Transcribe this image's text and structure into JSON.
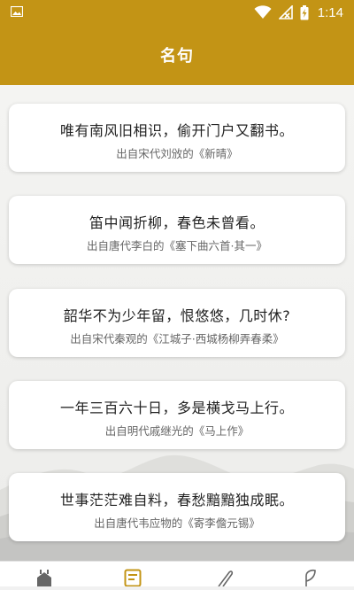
{
  "status_bar": {
    "time": "1:14",
    "icons": [
      "image-icon",
      "wifi-icon",
      "signal-off-icon",
      "battery-charging-icon"
    ]
  },
  "app_bar": {
    "title": "名句"
  },
  "colors": {
    "accent": "#c39415",
    "card_bg": "#ffffff",
    "text_primary": "#222222",
    "text_secondary": "#666666"
  },
  "quotes": [
    {
      "line": "唯有南风旧相识，偷开门户又翻书。",
      "source": "出自宋代刘攽的《新晴》"
    },
    {
      "line": "笛中闻折柳，春色未曾看。",
      "source": "出自唐代李白的《塞下曲六首·其一》"
    },
    {
      "line": "韶华不为少年留，恨悠悠，几时休?",
      "source": "出自宋代秦观的《江城子·西城杨柳弄春柔》"
    },
    {
      "line": "一年三百六十日，多是横戈马上行。",
      "source": "出自明代戚继光的《马上作》"
    },
    {
      "line": "世事茫茫难自料，春愁黯黯独成眠。",
      "source": "出自唐代韦应物的《寄李儋元锡》"
    }
  ],
  "bottom_nav": {
    "items": [
      {
        "icon": "home-icon"
      },
      {
        "icon": "quote-list-icon",
        "active": true
      },
      {
        "icon": "feather-icon"
      },
      {
        "icon": "leaf-icon"
      }
    ]
  }
}
